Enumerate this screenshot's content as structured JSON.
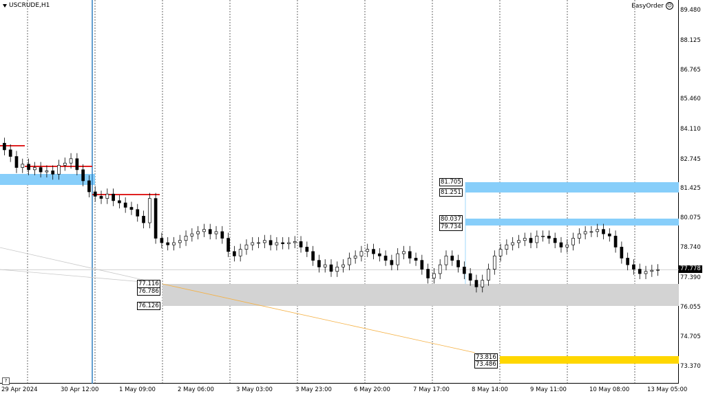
{
  "chart": {
    "symbol_title": "USCRUDE,H1",
    "panel_label": "EasyOrder",
    "help_label": "?",
    "last_price": "77.778"
  },
  "price_axis": [
    "89.480",
    "88.125",
    "86.765",
    "85.460",
    "84.110",
    "82.745",
    "81.425",
    "80.075",
    "78.740",
    "77.390",
    "76.055",
    "74.705",
    "73.370"
  ],
  "time_axis": [
    "29 Apr 2024",
    "30 Apr 12:00",
    "1 May 09:00",
    "2 May 06:00",
    "3 May 03:00",
    "3 May 23:00",
    "6 May 20:00",
    "7 May 17:00",
    "8 May 14:00",
    "9 May 11:00",
    "10 May 08:00",
    "13 May 05:00"
  ],
  "zone_labels": {
    "blue_upper_top": "81.705",
    "blue_upper_bottom": "81.251",
    "blue_lower_top": "80.037",
    "blue_lower_bottom": "79.734",
    "gray_top": "77.116",
    "gray_mid": "76.786",
    "gray_bottom": "76.126",
    "yellow_top": "73.816",
    "yellow_bottom": "73.486"
  },
  "colors": {
    "demand_zone": "#87cefa",
    "gray_zone": "#d3d3d3",
    "yellow_zone": "#ffd700",
    "resistance_line": "#e02020",
    "trend_line": "#f5b041",
    "vline": "#2f7fc1"
  },
  "chart_data": {
    "type": "candlestick",
    "symbol": "USCRUDE",
    "timeframe": "H1",
    "ylim": [
      73.0,
      90.0
    ],
    "close_path": [
      83.2,
      82.9,
      82.4,
      82.55,
      82.3,
      82.4,
      82.2,
      82.25,
      82.1,
      82.5,
      82.6,
      82.8,
      82.3,
      81.8,
      81.3,
      81.1,
      81.0,
      81.2,
      80.9,
      80.8,
      80.6,
      80.5,
      80.2,
      79.9,
      81.0,
      79.2,
      79.0,
      78.9,
      79.0,
      79.1,
      79.3,
      79.4,
      79.5,
      79.6,
      79.4,
      79.5,
      79.2,
      78.6,
      78.4,
      78.7,
      78.9,
      79.0,
      79.0,
      79.1,
      78.9,
      79.0,
      78.95,
      79.0,
      79.05,
      78.8,
      78.6,
      78.2,
      77.9,
      78.0,
      77.7,
      77.9,
      78.0,
      78.3,
      78.4,
      78.6,
      78.7,
      78.5,
      78.4,
      78.2,
      78.0,
      78.5,
      78.6,
      78.3,
      78.2,
      77.8,
      77.4,
      77.6,
      78.0,
      78.4,
      78.2,
      77.9,
      77.6,
      77.3,
      77.0,
      77.3,
      77.8,
      78.4,
      78.7,
      78.9,
      79.0,
      79.1,
      79.2,
      79.0,
      79.3,
      79.3,
      79.2,
      79.0,
      78.8,
      78.9,
      79.2,
      79.4,
      79.5,
      79.5,
      79.6,
      79.4,
      79.3,
      78.8,
      78.3,
      78.0,
      77.8,
      77.6,
      77.7,
      77.75,
      77.778
    ]
  }
}
